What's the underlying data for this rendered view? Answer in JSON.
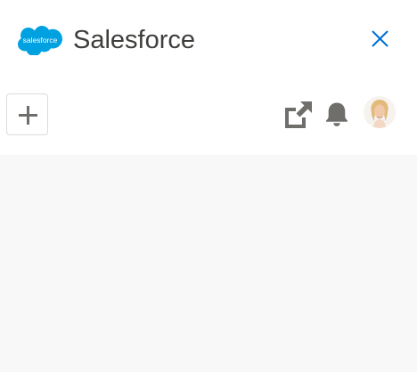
{
  "header": {
    "logo_text": "salesforce",
    "title": "Salesforce",
    "close_icon": "close-icon"
  },
  "toolbar": {
    "add_icon": "plus-icon",
    "popout_icon": "external-link-icon",
    "notifications_icon": "bell-icon",
    "avatar_icon": "user-avatar"
  },
  "colors": {
    "brand_blue": "#00a1e0",
    "close_blue": "#0070d2",
    "icon_gray": "#706e6b",
    "title_text": "#3e3e3c",
    "content_bg": "#f8f8f8",
    "border": "#dddbda"
  }
}
